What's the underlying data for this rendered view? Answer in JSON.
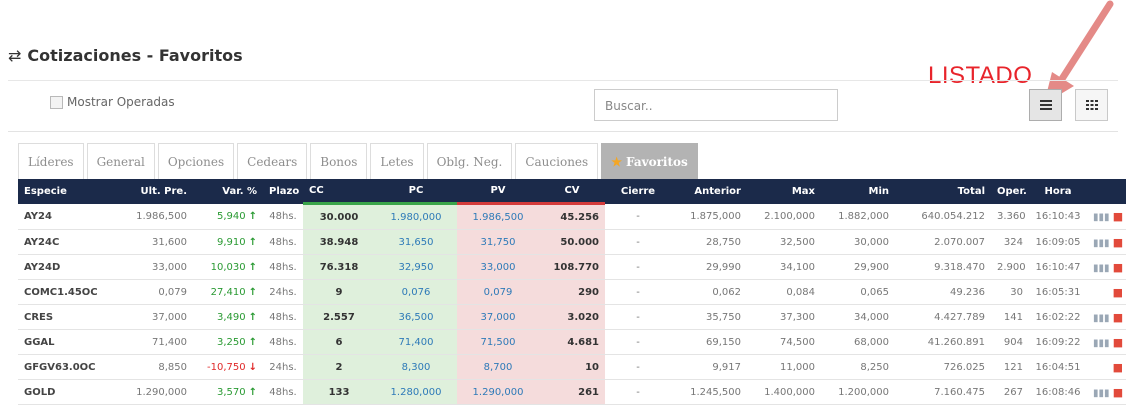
{
  "header": {
    "title": "Cotizaciones - Favoritos",
    "annotation": "LISTADO"
  },
  "filters": {
    "mostrar_operadas": "Mostrar Operadas",
    "search_placeholder": "Buscar.."
  },
  "tabs": [
    "Líderes",
    "General",
    "Opciones",
    "Cedears",
    "Bonos",
    "Letes",
    "Oblg. Neg.",
    "Cauciones",
    "Favoritos"
  ],
  "columns": [
    "Especie",
    "Ult. Pre.",
    "Var. %",
    "Plazo",
    "CC",
    "PC",
    "PV",
    "CV",
    "Cierre",
    "Anterior",
    "Max",
    "Min",
    "Total",
    "Oper.",
    "Hora"
  ],
  "rows": [
    {
      "especie": "AY24",
      "ult": "1.986,500",
      "var": "5,940",
      "dir": "up",
      "plazo": "48hs.",
      "cc": "30.000",
      "pc": "1.980,000",
      "pv": "1.986,500",
      "cv": "45.256",
      "cierre": "-",
      "anterior": "1.875,000",
      "max": "2.100,000",
      "min": "1.882,000",
      "total": "640.054.212",
      "oper": "3.360",
      "hora": "16:10:43",
      "chart": true
    },
    {
      "especie": "AY24C",
      "ult": "31,600",
      "var": "9,910",
      "dir": "up",
      "plazo": "48hs.",
      "cc": "38.948",
      "pc": "31,650",
      "pv": "31,750",
      "cv": "50.000",
      "cierre": "-",
      "anterior": "28,750",
      "max": "32,500",
      "min": "30,000",
      "total": "2.070.007",
      "oper": "324",
      "hora": "16:09:05",
      "chart": true
    },
    {
      "especie": "AY24D",
      "ult": "33,000",
      "var": "10,030",
      "dir": "up",
      "plazo": "48hs.",
      "cc": "76.318",
      "pc": "32,950",
      "pv": "33,000",
      "cv": "108.770",
      "cierre": "-",
      "anterior": "29,990",
      "max": "34,100",
      "min": "29,900",
      "total": "9.318.470",
      "oper": "2.900",
      "hora": "16:10:47",
      "chart": true
    },
    {
      "especie": "COMC1.45OC",
      "ult": "0,079",
      "var": "27,410",
      "dir": "up",
      "plazo": "24hs.",
      "cc": "9",
      "pc": "0,076",
      "pv": "0,079",
      "cv": "290",
      "cierre": "-",
      "anterior": "0,062",
      "max": "0,084",
      "min": "0,065",
      "total": "49.236",
      "oper": "30",
      "hora": "16:05:31",
      "chart": false
    },
    {
      "especie": "CRES",
      "ult": "37,000",
      "var": "3,490",
      "dir": "up",
      "plazo": "48hs.",
      "cc": "2.557",
      "pc": "36,500",
      "pv": "37,000",
      "cv": "3.020",
      "cierre": "-",
      "anterior": "35,750",
      "max": "37,300",
      "min": "34,000",
      "total": "4.427.789",
      "oper": "141",
      "hora": "16:02:22",
      "chart": true
    },
    {
      "especie": "GGAL",
      "ult": "71,400",
      "var": "3,250",
      "dir": "up",
      "plazo": "48hs.",
      "cc": "6",
      "pc": "71,400",
      "pv": "71,500",
      "cv": "4.681",
      "cierre": "-",
      "anterior": "69,150",
      "max": "74,500",
      "min": "68,000",
      "total": "41.260.891",
      "oper": "904",
      "hora": "16:09:22",
      "chart": true
    },
    {
      "especie": "GFGV63.0OC",
      "ult": "8,850",
      "var": "-10,750",
      "dir": "down",
      "plazo": "24hs.",
      "cc": "2",
      "pc": "8,300",
      "pv": "8,700",
      "cv": "10",
      "cierre": "-",
      "anterior": "9,917",
      "max": "11,000",
      "min": "8,250",
      "total": "726.025",
      "oper": "121",
      "hora": "16:04:51",
      "chart": false
    },
    {
      "especie": "GOLD",
      "ult": "1.290,000",
      "var": "3,570",
      "dir": "up",
      "plazo": "48hs.",
      "cc": "133",
      "pc": "1.280,000",
      "pv": "1.290,000",
      "cv": "261",
      "cierre": "-",
      "anterior": "1.245,500",
      "max": "1.400,000",
      "min": "1.200,000",
      "total": "7.160.475",
      "oper": "267",
      "hora": "16:08:46",
      "chart": true
    }
  ],
  "colors": {
    "header_bg": "#1b2a4a",
    "buy_bg": "#dff0dc",
    "sell_bg": "#f5dcdc",
    "up": "#2a9a33",
    "down": "#e02a2a",
    "annotation": "#e8242b"
  }
}
